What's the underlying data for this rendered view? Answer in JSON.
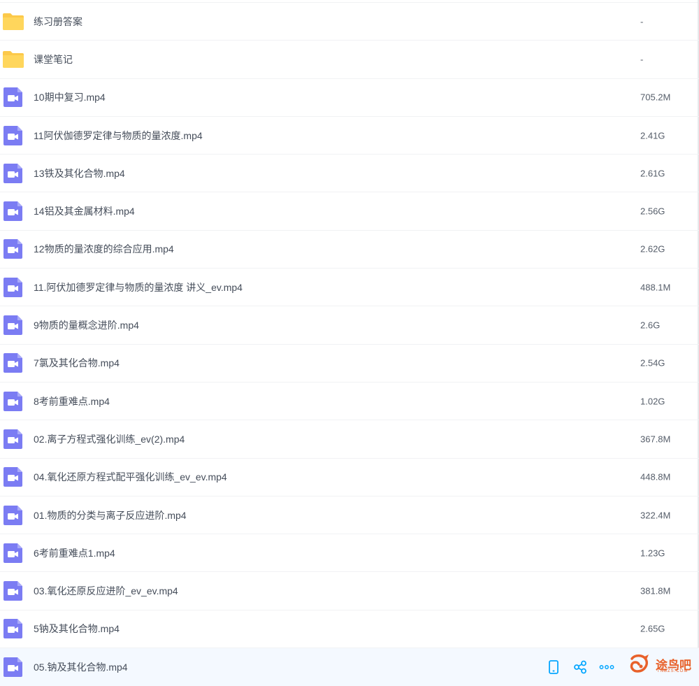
{
  "files": [
    {
      "name": "练习册答案",
      "size": "-",
      "type": "folder"
    },
    {
      "name": "课堂笔记",
      "size": "-",
      "type": "folder"
    },
    {
      "name": "10期中复习.mp4",
      "size": "705.2M",
      "type": "video"
    },
    {
      "name": "11阿伏伽德罗定律与物质的量浓度.mp4",
      "size": "2.41G",
      "type": "video"
    },
    {
      "name": "13铁及其化合物.mp4",
      "size": "2.61G",
      "type": "video"
    },
    {
      "name": "14铝及其金属材料.mp4",
      "size": "2.56G",
      "type": "video"
    },
    {
      "name": "12物质的量浓度的综合应用.mp4",
      "size": "2.62G",
      "type": "video"
    },
    {
      "name": "11.阿伏加德罗定律与物质的量浓度 讲义_ev.mp4",
      "size": "488.1M",
      "type": "video"
    },
    {
      "name": "9物质的量概念进阶.mp4",
      "size": "2.6G",
      "type": "video"
    },
    {
      "name": "7氯及其化合物.mp4",
      "size": "2.54G",
      "type": "video"
    },
    {
      "name": "8考前重难点.mp4",
      "size": "1.02G",
      "type": "video"
    },
    {
      "name": "02.离子方程式强化训练_ev(2).mp4",
      "size": "367.8M",
      "type": "video"
    },
    {
      "name": "04.氧化还原方程式配平强化训练_ev_ev.mp4",
      "size": "448.8M",
      "type": "video"
    },
    {
      "name": "01.物质的分类与离子反应进阶.mp4",
      "size": "322.4M",
      "type": "video"
    },
    {
      "name": "6考前重难点1.mp4",
      "size": "1.23G",
      "type": "video"
    },
    {
      "name": "03.氧化还原反应进阶_ev_ev.mp4",
      "size": "381.8M",
      "type": "video"
    },
    {
      "name": "5钠及其化合物.mp4",
      "size": "2.65G",
      "type": "video"
    },
    {
      "name": "05.钠及其化合物.mp4",
      "size": "",
      "type": "video",
      "hovered": true
    }
  ],
  "hover_actions": [
    {
      "icon": "phone-icon",
      "label": ""
    },
    {
      "icon": "share-icon",
      "label": ""
    },
    {
      "icon": "more-icon",
      "label": ""
    }
  ],
  "watermark": {
    "text": "途鸟吧",
    "sub": "TNBZS.COM"
  },
  "colors": {
    "folder": "#fcc94a",
    "video": "#7b7cf3",
    "accent": "#06a7ff",
    "hover_bg": "#f4f9ff",
    "watermark": "#e8612a"
  }
}
